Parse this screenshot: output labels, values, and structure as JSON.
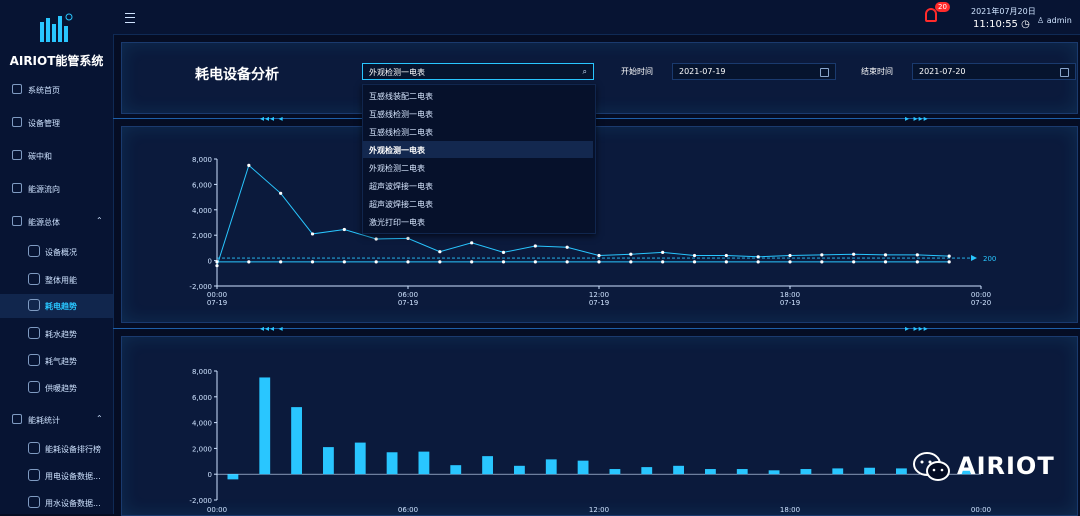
{
  "sidebar": {
    "brand": "AIRIOT能管系统",
    "items": [
      {
        "label": "系统首页",
        "icon": "home-icon",
        "sub": false,
        "top": 78
      },
      {
        "label": "设备管理",
        "icon": "device-icon",
        "sub": false,
        "top": 111
      },
      {
        "label": "碳中和",
        "icon": "carbon-icon",
        "sub": false,
        "top": 144
      },
      {
        "label": "能源流向",
        "icon": "flow-icon",
        "sub": false,
        "top": 177
      },
      {
        "label": "能源总体",
        "icon": "energy-icon",
        "sub": false,
        "chev": "⌃",
        "top": 210
      },
      {
        "label": "设备概况",
        "icon": "cube-icon",
        "sub": true,
        "top": 240
      },
      {
        "label": "整体用能",
        "icon": "cube-icon",
        "sub": true,
        "top": 268
      },
      {
        "label": "耗电趋势",
        "icon": "cube-icon",
        "sub": true,
        "active": true,
        "top": 294
      },
      {
        "label": "耗水趋势",
        "icon": "cube-icon",
        "sub": true,
        "top": 322
      },
      {
        "label": "耗气趋势",
        "icon": "cube-icon",
        "sub": true,
        "top": 349
      },
      {
        "label": "供暖趋势",
        "icon": "cube-icon",
        "sub": true,
        "top": 376
      },
      {
        "label": "能耗统计",
        "icon": "stats-icon",
        "sub": false,
        "chev": "⌃",
        "top": 408
      },
      {
        "label": "能耗设备排行榜",
        "icon": "cube-icon",
        "sub": true,
        "top": 437
      },
      {
        "label": "用电设备数据...",
        "icon": "cube-icon",
        "sub": true,
        "top": 464
      },
      {
        "label": "用水设备数据...",
        "icon": "cube-icon",
        "sub": true,
        "top": 491
      }
    ]
  },
  "topbar": {
    "notifications": "20",
    "date": "2021年07月20日",
    "time": "11:10:55",
    "user": "admin"
  },
  "filters": {
    "title": "耗电设备分析",
    "device_value": "外观检测一电表",
    "start_label": "开始时间",
    "start_value": "2021-07-19",
    "end_label": "结束时间",
    "end_value": "2021-07-20"
  },
  "dropdown": {
    "options": [
      {
        "label": "互感线装配二电表",
        "selected": false
      },
      {
        "label": "互感线检测一电表",
        "selected": false
      },
      {
        "label": "互感线检测二电表",
        "selected": false
      },
      {
        "label": "外观检测一电表",
        "selected": true
      },
      {
        "label": "外观检测二电表",
        "selected": false
      },
      {
        "label": "超声波焊接一电表",
        "selected": false
      },
      {
        "label": "超声波焊接二电表",
        "selected": false
      },
      {
        "label": "激光打印一电表",
        "selected": false
      }
    ]
  },
  "watermark": "AIRIOT",
  "chart_data": [
    {
      "type": "line",
      "ylim": [
        -2000,
        8000
      ],
      "yticks": [
        -2000,
        0,
        2000,
        4000,
        6000,
        8000
      ],
      "ytick_labels": [
        "-2,000",
        "0",
        "2,000",
        "4,000",
        "6,000",
        "8,000"
      ],
      "x_ticks": [
        {
          "pos": 0,
          "time": "00:00",
          "date": "07-19"
        },
        {
          "pos": 6,
          "time": "06:00",
          "date": "07-19"
        },
        {
          "pos": 12,
          "time": "12:00",
          "date": "07-19"
        },
        {
          "pos": 18,
          "time": "18:00",
          "date": "07-19"
        },
        {
          "pos": 24,
          "time": "00:00",
          "date": "07-20"
        }
      ],
      "xlim": [
        0,
        24
      ],
      "markline_label": "200",
      "markline_value": 200,
      "series": [
        {
          "x": [
            0,
            1,
            2,
            3,
            4,
            5,
            6,
            7,
            8,
            9,
            10,
            11,
            12,
            13,
            14,
            15,
            16,
            17,
            18,
            19,
            20,
            21,
            22,
            23
          ],
          "values": [
            -400,
            7500,
            5300,
            2100,
            2450,
            1700,
            1750,
            700,
            1400,
            650,
            1150,
            1050,
            400,
            500,
            650,
            400,
            400,
            300,
            400,
            450,
            500,
            450,
            450,
            350
          ]
        },
        {
          "x": [
            0,
            1,
            2,
            3,
            4,
            5,
            6,
            7,
            8,
            9,
            10,
            11,
            12,
            13,
            14,
            15,
            16,
            17,
            18,
            19,
            20,
            21,
            22,
            23
          ],
          "values": [
            -100,
            -100,
            -100,
            -100,
            -100,
            -100,
            -100,
            -100,
            -100,
            -100,
            -100,
            -100,
            -100,
            -100,
            -100,
            -100,
            -100,
            -100,
            -100,
            -100,
            -100,
            -100,
            -100,
            -100
          ]
        }
      ]
    },
    {
      "type": "bar",
      "ylim": [
        -2000,
        8000
      ],
      "yticks": [
        -2000,
        0,
        2000,
        4000,
        6000,
        8000
      ],
      "ytick_labels": [
        "-2,000",
        "0",
        "2,000",
        "4,000",
        "6,000",
        "8,000"
      ],
      "x_ticks": [
        {
          "pos": 0,
          "label": "00:00"
        },
        {
          "pos": 6,
          "label": "06:00"
        },
        {
          "pos": 12,
          "label": "12:00"
        },
        {
          "pos": 18,
          "label": "18:00"
        },
        {
          "pos": 24,
          "label": "00:00"
        }
      ],
      "xlim": [
        0,
        24
      ],
      "values": [
        -400,
        7500,
        5200,
        2100,
        2450,
        1700,
        1750,
        700,
        1400,
        650,
        1150,
        1050,
        400,
        550,
        650,
        400,
        400,
        300,
        400,
        450,
        500,
        450,
        450,
        350
      ]
    }
  ]
}
